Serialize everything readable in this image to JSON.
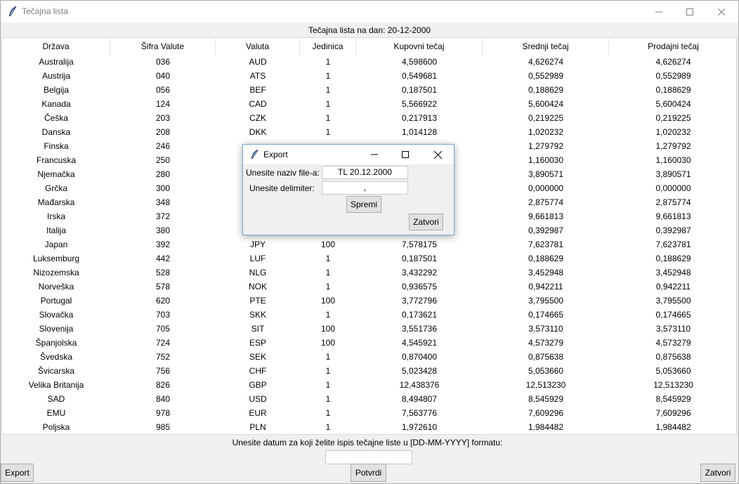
{
  "window": {
    "title": "Tečajna lista",
    "icon": "feather-icon"
  },
  "caption": "Tečajna lista na dan: 20-12-2000",
  "table": {
    "columns": [
      "Država",
      "Šifra Valute",
      "Valuta",
      "Jedinica",
      "Kupovni tečaj",
      "Srednji tečaj",
      "Prodajni tečaj"
    ],
    "rows": [
      [
        "Australija",
        "036",
        "AUD",
        "1",
        "4,598600",
        "4,626274",
        "4,626274"
      ],
      [
        "Austrija",
        "040",
        "ATS",
        "1",
        "0,549681",
        "0,552989",
        "0,552989"
      ],
      [
        "Belgija",
        "056",
        "BEF",
        "1",
        "0,187501",
        "0,188629",
        "0,188629"
      ],
      [
        "Kanada",
        "124",
        "CAD",
        "1",
        "5,566922",
        "5,600424",
        "5,600424"
      ],
      [
        "Češka",
        "203",
        "CZK",
        "1",
        "0,217913",
        "0,219225",
        "0,219225"
      ],
      [
        "Danska",
        "208",
        "DKK",
        "1",
        "1,014128",
        "1,020232",
        "1,020232"
      ],
      [
        "Finska",
        "246",
        "",
        "",
        "",
        "1,279792",
        "1,279792"
      ],
      [
        "Francuska",
        "250",
        "",
        "",
        "",
        "1,160030",
        "1,160030"
      ],
      [
        "Njemačka",
        "280",
        "",
        "",
        "",
        "3,890571",
        "3,890571"
      ],
      [
        "Grčka",
        "300",
        "",
        "",
        "",
        "0,000000",
        "0,000000"
      ],
      [
        "Mađarska",
        "348",
        "",
        "",
        "",
        "2,875774",
        "2,875774"
      ],
      [
        "Irska",
        "372",
        "",
        "",
        "",
        "9,661813",
        "9,661813"
      ],
      [
        "Italija",
        "380",
        "",
        "",
        "",
        "0,392987",
        "0,392987"
      ],
      [
        "Japan",
        "392",
        "JPY",
        "100",
        "7,578175",
        "7,623781",
        "7,623781"
      ],
      [
        "Luksemburg",
        "442",
        "LUF",
        "1",
        "0,187501",
        "0,188629",
        "0,188629"
      ],
      [
        "Nizozemska",
        "528",
        "NLG",
        "1",
        "3,432292",
        "3,452948",
        "3,452948"
      ],
      [
        "Norveška",
        "578",
        "NOK",
        "1",
        "0,936575",
        "0,942211",
        "0,942211"
      ],
      [
        "Portugal",
        "620",
        "PTE",
        "100",
        "3,772796",
        "3,795500",
        "3,795500"
      ],
      [
        "Slovačka",
        "703",
        "SKK",
        "1",
        "0,173621",
        "0,174665",
        "0,174665"
      ],
      [
        "Slovenija",
        "705",
        "SIT",
        "100",
        "3,551736",
        "3,573110",
        "3,573110"
      ],
      [
        "Španjolska",
        "724",
        "ESP",
        "100",
        "4,545921",
        "4,573279",
        "4,573279"
      ],
      [
        "Švedska",
        "752",
        "SEK",
        "1",
        "0,870400",
        "0,875638",
        "0,875638"
      ],
      [
        "Švicarska",
        "756",
        "CHF",
        "1",
        "5,023428",
        "5,053660",
        "5,053660"
      ],
      [
        "Velika Britanija",
        "826",
        "GBP",
        "1",
        "12,438376",
        "12,513230",
        "12,513230"
      ],
      [
        "SAD",
        "840",
        "USD",
        "1",
        "8,494807",
        "8,545929",
        "8,545929"
      ],
      [
        "EMU",
        "978",
        "EUR",
        "1",
        "7,563776",
        "7,609296",
        "7,609296"
      ],
      [
        "Poljska",
        "985",
        "PLN",
        "1",
        "1,972610",
        "1,984482",
        "1,984482"
      ]
    ]
  },
  "prompt": "Unesite datum za koji želite ispis tečajne liste u [DD-MM-YYYY] formatu:",
  "date_input": {
    "value": ""
  },
  "buttons": {
    "export": "Export",
    "potvrdi": "Potvrdi",
    "zatvori": "Zatvori"
  },
  "dialog": {
    "title": "Export",
    "filename_label": "Unesite naziv file-a:",
    "filename_value": "TL 20.12.2000",
    "delimiter_label": "Unesite delimiter:",
    "delimiter_value": ",",
    "save_button": "Spremi",
    "close_button": "Zatvori"
  }
}
